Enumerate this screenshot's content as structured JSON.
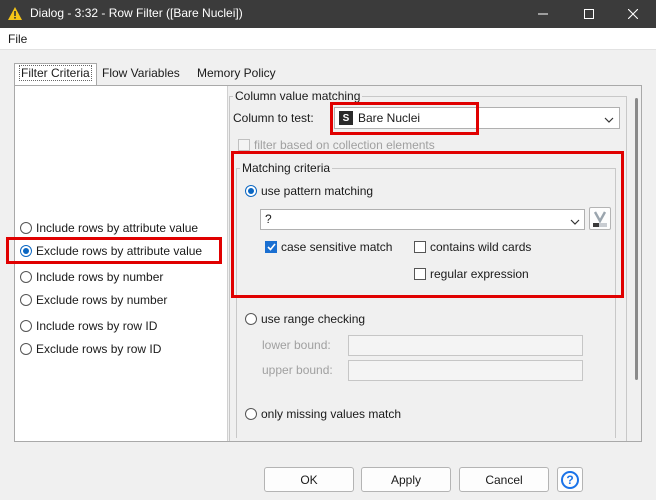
{
  "window": {
    "title": "Dialog - 3:32 - Row Filter ([Bare Nuclei])"
  },
  "menu": {
    "file_label": "File"
  },
  "tabs": [
    {
      "label": "Filter Criteria"
    },
    {
      "label": "Flow Variables"
    },
    {
      "label": "Memory Policy"
    }
  ],
  "filter_options": [
    {
      "label": "Include rows by attribute value",
      "selected": false
    },
    {
      "label": "Exclude rows by attribute value",
      "selected": true
    },
    {
      "label": "Include rows by number",
      "selected": false
    },
    {
      "label": "Exclude rows by number",
      "selected": false
    },
    {
      "label": "Include rows by row ID",
      "selected": false
    },
    {
      "label": "Exclude rows by row ID",
      "selected": false
    }
  ],
  "column_matching": {
    "group_title": "Column value matching",
    "column_to_test_label": "Column to test:",
    "column_type_badge": "S",
    "column_value": "Bare Nuclei",
    "collection_filter_label": "filter based on collection elements"
  },
  "matching_criteria": {
    "group_title": "Matching criteria",
    "pattern_option_label": "use pattern matching",
    "pattern_value": "?",
    "case_sensitive_label": "case sensitive match",
    "case_sensitive_checked": true,
    "wild_cards_label": "contains wild cards",
    "wild_cards_checked": false,
    "regex_label": "regular expression",
    "regex_checked": false,
    "range_option_label": "use range checking",
    "lower_bound_label": "lower bound:",
    "upper_bound_label": "upper bound:",
    "missing_option_label": "only missing values match"
  },
  "buttons": {
    "ok": "OK",
    "apply": "Apply",
    "cancel": "Cancel",
    "help": "?"
  },
  "colors": {
    "highlight_red": "#e00000",
    "accent_blue": "#0a66c2",
    "titlebar": "#3b3b3b"
  }
}
